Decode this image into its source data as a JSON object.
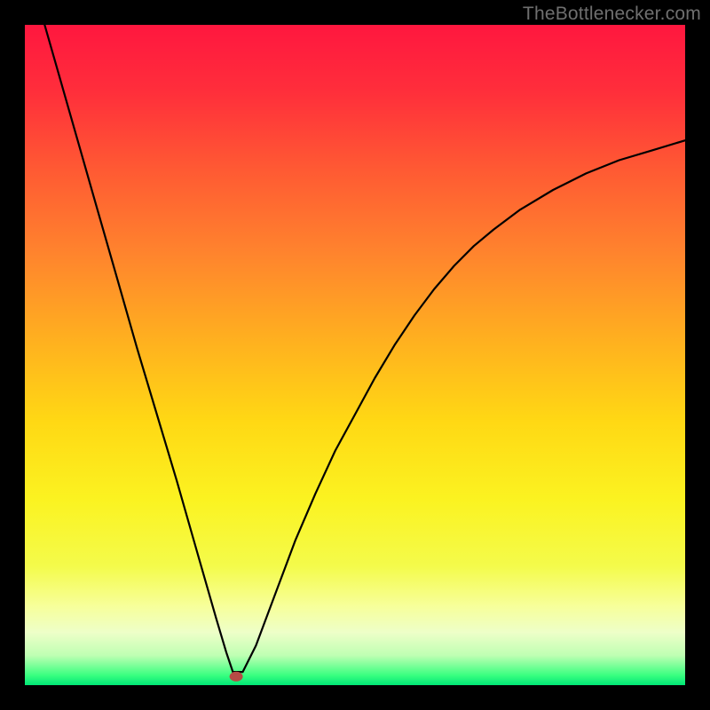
{
  "watermark": "TheBottlenecker.com",
  "chart_data": {
    "type": "line",
    "title": "",
    "xlabel": "",
    "ylabel": "",
    "xlim": [
      0,
      100
    ],
    "ylim": [
      0,
      100
    ],
    "grid": false,
    "legend": false,
    "series": [
      {
        "name": "bottleneck-curve",
        "x": [
          3,
          5,
          8,
          11,
          14,
          17,
          20,
          23,
          26,
          29,
          30.5,
          31.5,
          33,
          35,
          38,
          41,
          44,
          47,
          50,
          53,
          56,
          59,
          62,
          65,
          68,
          71,
          75,
          80,
          85,
          90,
          95,
          100
        ],
        "values": [
          100,
          93,
          82.5,
          72,
          61.5,
          51,
          41,
          31,
          20.5,
          10,
          5,
          2,
          2,
          6,
          14,
          22,
          29,
          35.5,
          41,
          46.5,
          51.5,
          56,
          60,
          63.5,
          66.5,
          69,
          72,
          75,
          77.5,
          79.5,
          81,
          82.5
        ]
      }
    ],
    "annotations": [
      {
        "name": "min-marker",
        "x": 32,
        "y": 1.3
      }
    ],
    "background_gradient_stops": [
      {
        "offset": 0.0,
        "color": "#ff173f"
      },
      {
        "offset": 0.1,
        "color": "#ff2e3b"
      },
      {
        "offset": 0.22,
        "color": "#ff5a33"
      },
      {
        "offset": 0.35,
        "color": "#ff852d"
      },
      {
        "offset": 0.48,
        "color": "#ffb11f"
      },
      {
        "offset": 0.6,
        "color": "#ffd814"
      },
      {
        "offset": 0.72,
        "color": "#fbf321"
      },
      {
        "offset": 0.82,
        "color": "#f4fb4b"
      },
      {
        "offset": 0.88,
        "color": "#f7ff9a"
      },
      {
        "offset": 0.92,
        "color": "#eeffc8"
      },
      {
        "offset": 0.955,
        "color": "#bfffb3"
      },
      {
        "offset": 0.985,
        "color": "#3aff80"
      },
      {
        "offset": 1.0,
        "color": "#00e676"
      }
    ]
  }
}
